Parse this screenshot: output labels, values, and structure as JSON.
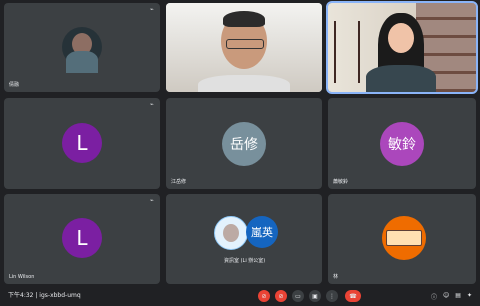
{
  "tiles": [
    {
      "name": "倩融",
      "avatar": "photo"
    },
    {
      "name": "",
      "avatar": "video-man"
    },
    {
      "name": "",
      "avatar": "video-woman"
    },
    {
      "name": "",
      "avatar": "L"
    },
    {
      "name": "江岳修",
      "avatar": "岳修"
    },
    {
      "name": "蕭敏鈴",
      "avatar": "敏鈴"
    },
    {
      "name": "Lin Wilson",
      "avatar": "L"
    },
    {
      "name": "資訊室 (Li 辦公室)",
      "avatar": "嵐英"
    },
    {
      "name": "林",
      "avatar": "stamp"
    }
  ],
  "bottom": {
    "meeting_info": "下午4:32 | igs-xbbd-umq"
  },
  "colors": {
    "tile_bg": "#3c4043",
    "page_bg": "#202124",
    "avatar_purple": "#7b1fa2",
    "avatar_gray": "#78909c",
    "avatar_magenta": "#ab47bc",
    "avatar_blue": "#1565c0",
    "avatar_orange": "#ef6c00",
    "end_call_red": "#ea4335"
  }
}
